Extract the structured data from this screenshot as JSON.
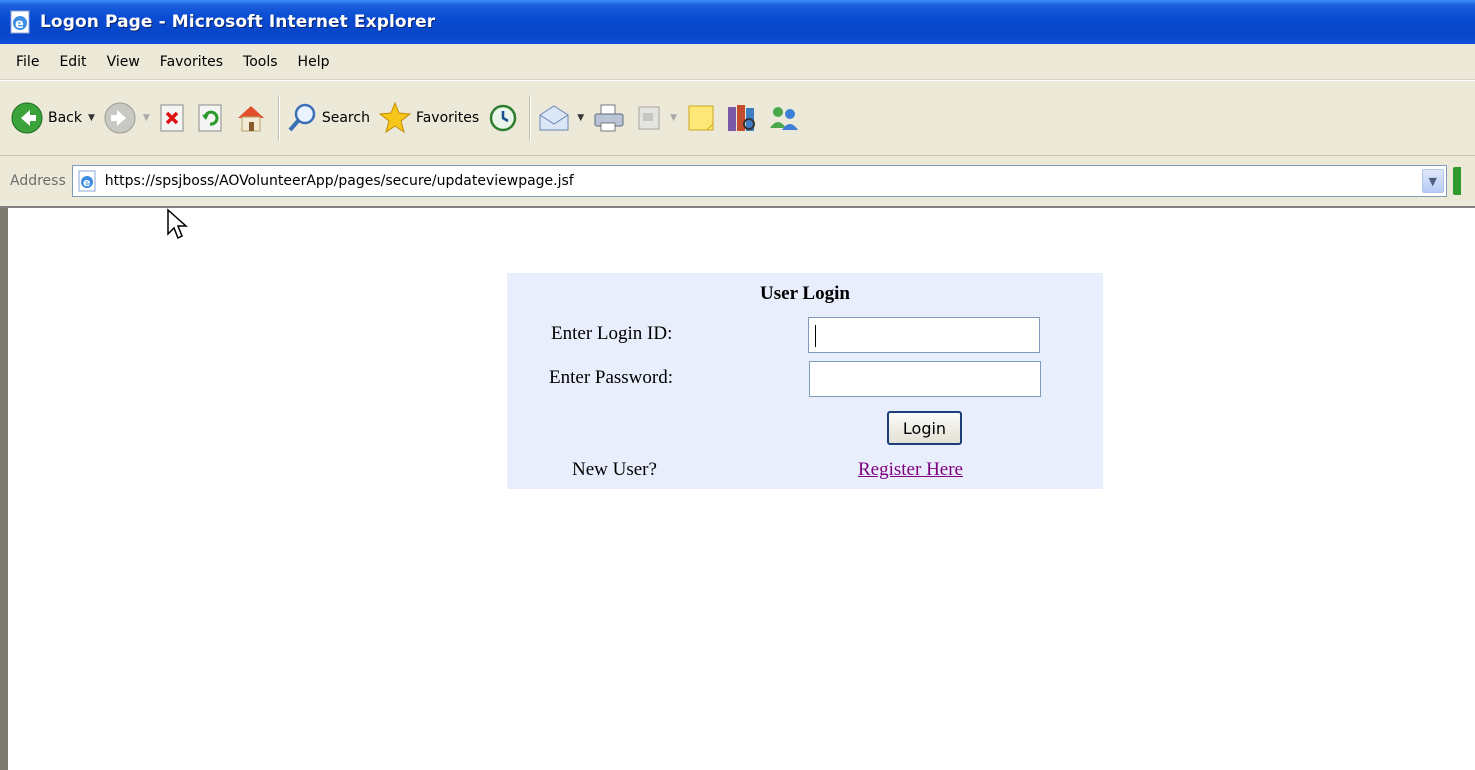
{
  "window": {
    "title": "Logon Page - Microsoft Internet Explorer",
    "icon": "ie-page-icon"
  },
  "menu": {
    "items": [
      "File",
      "Edit",
      "View",
      "Favorites",
      "Tools",
      "Help"
    ]
  },
  "toolbar": {
    "back_label": "Back",
    "search_label": "Search",
    "favorites_label": "Favorites"
  },
  "address": {
    "label": "Address",
    "url": "https://spsjboss/AOVolunteerApp/pages/secure/updateviewpage.jsf"
  },
  "login": {
    "title": "User Login",
    "login_id_label": "Enter Login ID:",
    "login_id_value": "",
    "password_label": "Enter Password:",
    "password_value": "",
    "submit_label": "Login",
    "new_user_label": "New User?",
    "register_link": "Register Here"
  },
  "colors": {
    "titlebar": "#0a4bd3",
    "chrome": "#ece9d8",
    "panel_bg": "#e8eefb",
    "visited_link": "#800080"
  }
}
